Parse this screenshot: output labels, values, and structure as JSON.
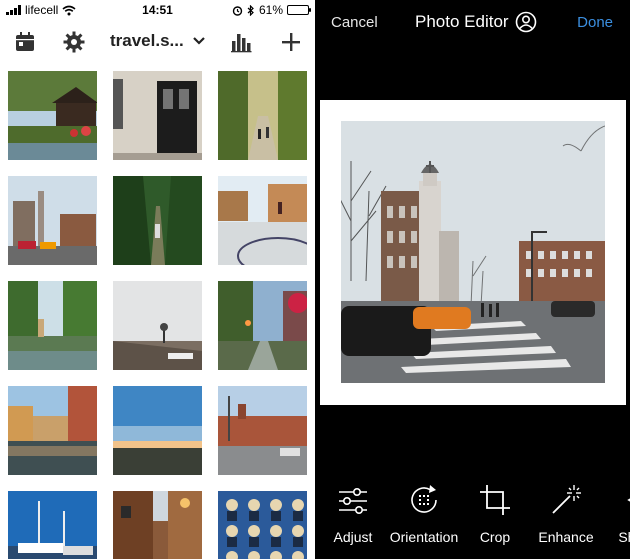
{
  "status": {
    "carrier": "lifecell",
    "time": "14:51",
    "battery": "61%",
    "battery_level": 0.61
  },
  "feed": {
    "account": "travel.s...",
    "icons": [
      "calendar-icon",
      "gear-icon",
      "chevron-down-icon",
      "bar-chart-icon",
      "plus-icon"
    ]
  },
  "editor": {
    "cancel": "Cancel",
    "title": "Photo Editor",
    "done": "Done",
    "accent": "#3b8fe0",
    "tools": [
      {
        "label": "Adjust",
        "icon": "sliders-icon"
      },
      {
        "label": "Orientation",
        "icon": "rotate-icon"
      },
      {
        "label": "Crop",
        "icon": "crop-icon"
      },
      {
        "label": "Enhance",
        "icon": "magic-wand-icon"
      },
      {
        "label": "Share",
        "icon": "share-icon"
      }
    ]
  }
}
